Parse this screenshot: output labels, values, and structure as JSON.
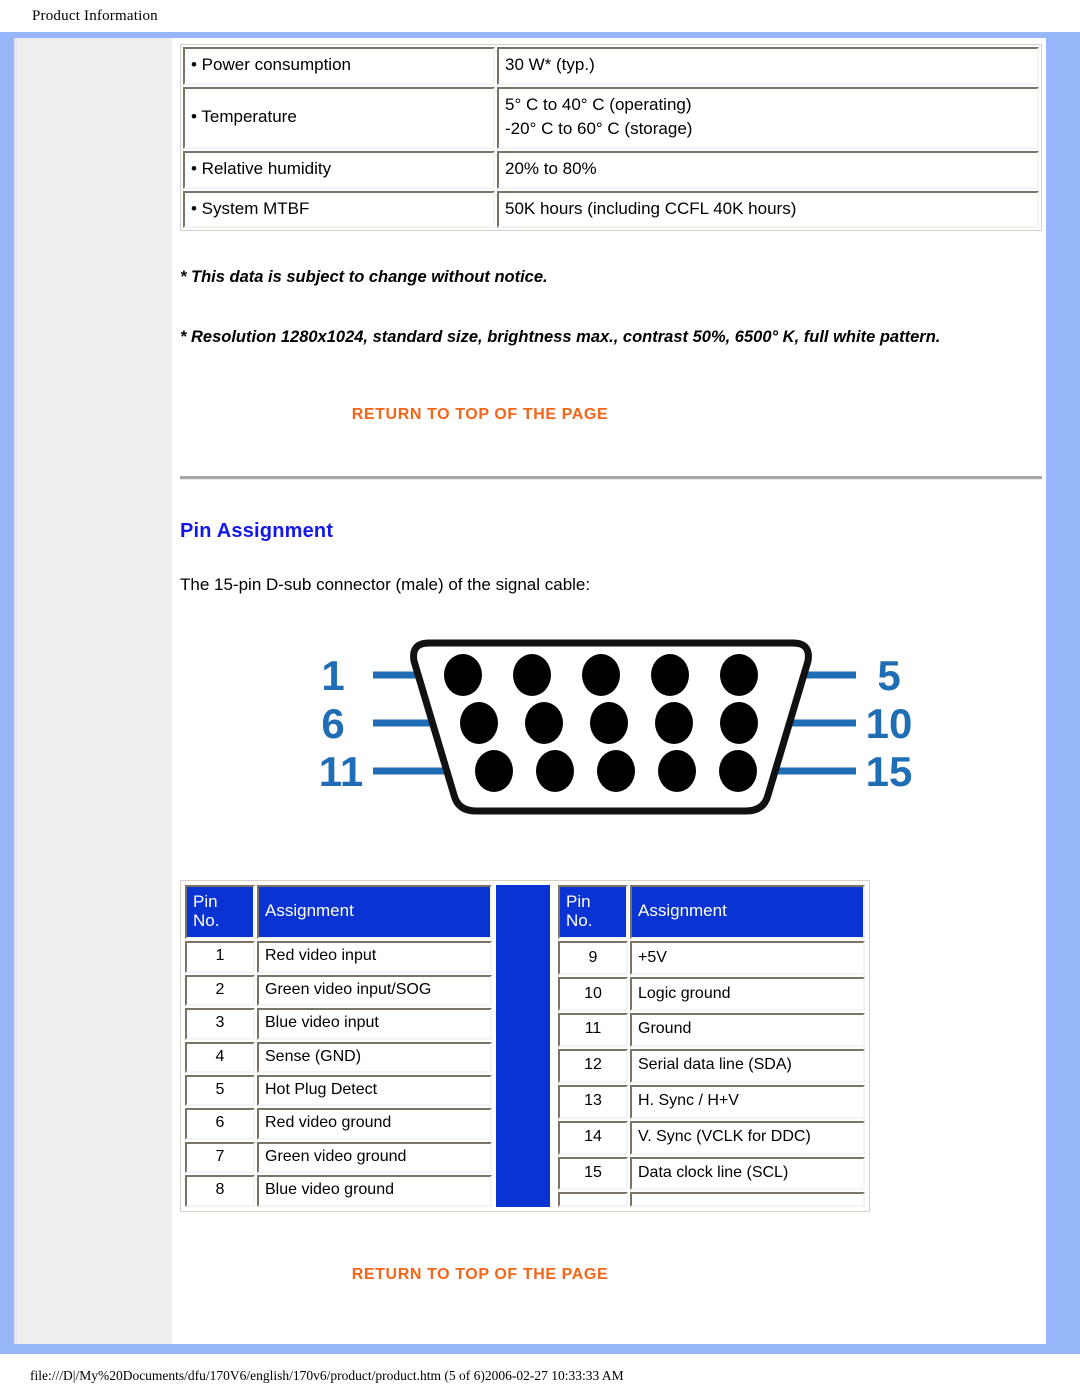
{
  "header": {
    "title": "Product Information"
  },
  "spec_table": {
    "rows": [
      {
        "label": "• Power consumption",
        "value": "30 W* (typ.)"
      },
      {
        "label": "• Temperature",
        "value": "5° C to 40° C (operating)\n-20° C to 60° C (storage)"
      },
      {
        "label": "• Relative humidity",
        "value": "20% to 80%"
      },
      {
        "label": "• System MTBF",
        "value": "50K hours (including CCFL 40K hours)"
      }
    ]
  },
  "notes": {
    "note1": "* This data is subject to change without notice.",
    "note2": "* Resolution 1280x1024, standard size, brightness max., contrast 50%, 6500° K, full white pattern."
  },
  "links": {
    "return_top": "RETURN TO TOP OF THE PAGE"
  },
  "pin_assignment": {
    "heading": "Pin Assignment",
    "intro": "The 15-pin D-sub connector (male) of the signal cable:",
    "connector": {
      "labels": [
        "1",
        "5",
        "6",
        "10",
        "11",
        "15"
      ],
      "label_color": "#1f6db4",
      "pin_color": "#000000",
      "rows": [
        5,
        5,
        5
      ]
    },
    "table": {
      "headers": {
        "pin_no": "Pin\nNo.",
        "assignment": "Assignment"
      },
      "left_rows": [
        {
          "pin": "1",
          "assignment": "Red video input"
        },
        {
          "pin": "2",
          "assignment": "Green video input/SOG"
        },
        {
          "pin": "3",
          "assignment": "Blue video input"
        },
        {
          "pin": "4",
          "assignment": "Sense (GND)"
        },
        {
          "pin": "5",
          "assignment": "Hot Plug Detect"
        },
        {
          "pin": "6",
          "assignment": "Red video ground"
        },
        {
          "pin": "7",
          "assignment": "Green video ground"
        },
        {
          "pin": "8",
          "assignment": "Blue video ground"
        }
      ],
      "right_rows": [
        {
          "pin": "9",
          "assignment": "+5V"
        },
        {
          "pin": "10",
          "assignment": "Logic ground"
        },
        {
          "pin": "11",
          "assignment": "Ground"
        },
        {
          "pin": "12",
          "assignment": "Serial data line (SDA)"
        },
        {
          "pin": "13",
          "assignment": "H. Sync / H+V"
        },
        {
          "pin": "14",
          "assignment": "V. Sync (VCLK for DDC)"
        },
        {
          "pin": "15",
          "assignment": "Data clock line (SCL)"
        }
      ]
    }
  },
  "footer": {
    "path": "file:///D|/My%20Documents/dfu/170V6/english/170v6/product/product.htm (5 of 6)2006-02-27 10:33:33 AM"
  },
  "colors": {
    "page_border": "#96b8fa",
    "sidebar": "#eeeeee",
    "table_header_blue": "#0a33d3",
    "link_orange": "#f4651a",
    "heading_blue": "#1318e8"
  }
}
